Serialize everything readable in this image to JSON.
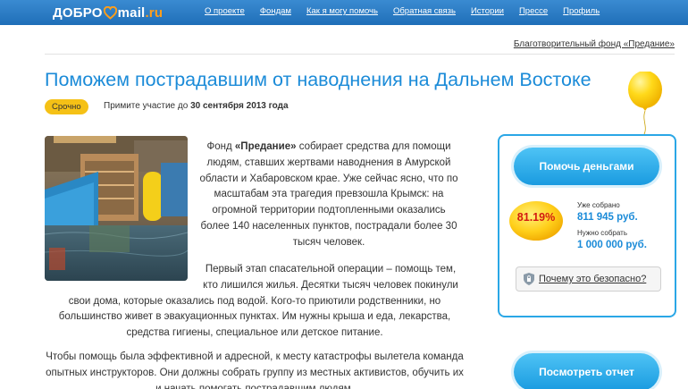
{
  "header": {
    "logo_left": "ДОБРО",
    "logo_mail": "mail",
    "logo_ru": ".ru",
    "nav": [
      "О проекте",
      "Фондам",
      "Как я могу помочь",
      "Обратная связь",
      "Истории",
      "Прессе",
      "Профиль"
    ]
  },
  "fund_link": "Благотворительный фонд «Предание»",
  "title": "Поможем пострадавшим от наводнения на Дальнем Востоке",
  "badge": "Срочно",
  "deadline": {
    "prefix": "Примите участие до",
    "date": "30 сентября 2013 года"
  },
  "article": {
    "p1_before": "Фонд ",
    "p1_bold": "«Предание»",
    "p1_after": " собирает средства для помощи людям, ставших жертвами наводнения в Амурской области и Хабаровском крае. Уже сейчас ясно, что по масштабам эта трагедия превзошла Крымск: на огромной территории подтопленными оказались более 140 населенных пунктов, пострадали более 30 тысяч человек.",
    "p2_line1": "Первый этап спасательной операции – помощь тем, кто лишился жилья. Десятки тысяч человек покинули",
    "p2_rest": "свои дома, которые оказались под водой. Кого-то приютили родственники, но большинство живет в эвакуационных пунктах. Им нужны крыша и еда, лекарства, средства гигиены, специальное или детское питание.",
    "p3": "Чтобы помощь была эффективной и адресной, к месту катастрофы вылетела команда опытных инструкторов. Они должны собрать группу из местных активистов, обучить их и начать помогать пострадавшим людям."
  },
  "sidebar": {
    "help_button": "Помочь деньгами",
    "percent": "81.19%",
    "progress_fraction": 0.8119,
    "collected_label": "Уже собрано",
    "collected_value": "811 945 руб.",
    "needed_label": "Нужно собрать",
    "needed_value": "1 000 000 руб.",
    "safe_button": "Почему это безопасно?",
    "report_button": "Посмотреть отчет"
  },
  "colors": {
    "brand_blue": "#1b8bd8",
    "accent_yellow": "#f5c116",
    "percent_red": "#d31a10",
    "button_blue": "#1a9be0"
  }
}
